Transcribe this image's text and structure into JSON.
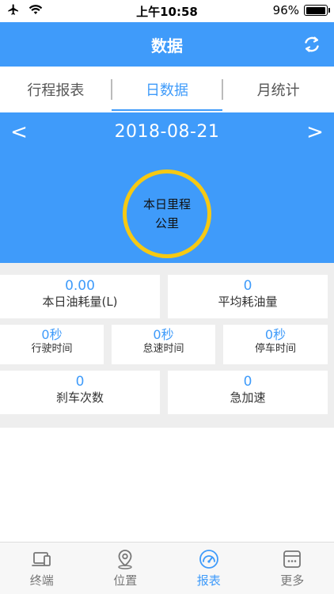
{
  "status_bar": {
    "time": "上午10:58",
    "battery": "96%",
    "battery_level": 0.96
  },
  "header": {
    "title": "数据",
    "refresh_icon": "refresh-icon"
  },
  "tabs": [
    {
      "label": "行程报表",
      "active": false
    },
    {
      "label": "日数据",
      "active": true
    },
    {
      "label": "月统计",
      "active": false
    }
  ],
  "date_nav": {
    "prev": "<",
    "date": "2018-08-21",
    "next": ">"
  },
  "daily_mileage": {
    "label": "本日里程",
    "unit": "公里"
  },
  "stats": {
    "fuel_today": {
      "value": "0.00",
      "label": "本日油耗量(L)"
    },
    "avg_fuel": {
      "value": "0",
      "label": "平均耗油量"
    },
    "drive_time": {
      "value": "0秒",
      "label": "行驶时间"
    },
    "idle_time": {
      "value": "0秒",
      "label": "怠速时间"
    },
    "park_time": {
      "value": "0秒",
      "label": "停车时间"
    },
    "brake_count": {
      "value": "0",
      "label": "刹车次数"
    },
    "rapid_accel": {
      "value": "0",
      "label": "急加速"
    }
  },
  "tabbar": [
    {
      "label": "终端",
      "icon": "terminal-icon",
      "active": false
    },
    {
      "label": "位置",
      "icon": "location-pin-icon",
      "active": false
    },
    {
      "label": "报表",
      "icon": "report-gauge-icon",
      "active": true
    },
    {
      "label": "更多",
      "icon": "more-icon",
      "active": false
    }
  ],
  "colors": {
    "primary": "#3f9bfa",
    "ring": "#f6c913",
    "background": "#eeeeee"
  }
}
